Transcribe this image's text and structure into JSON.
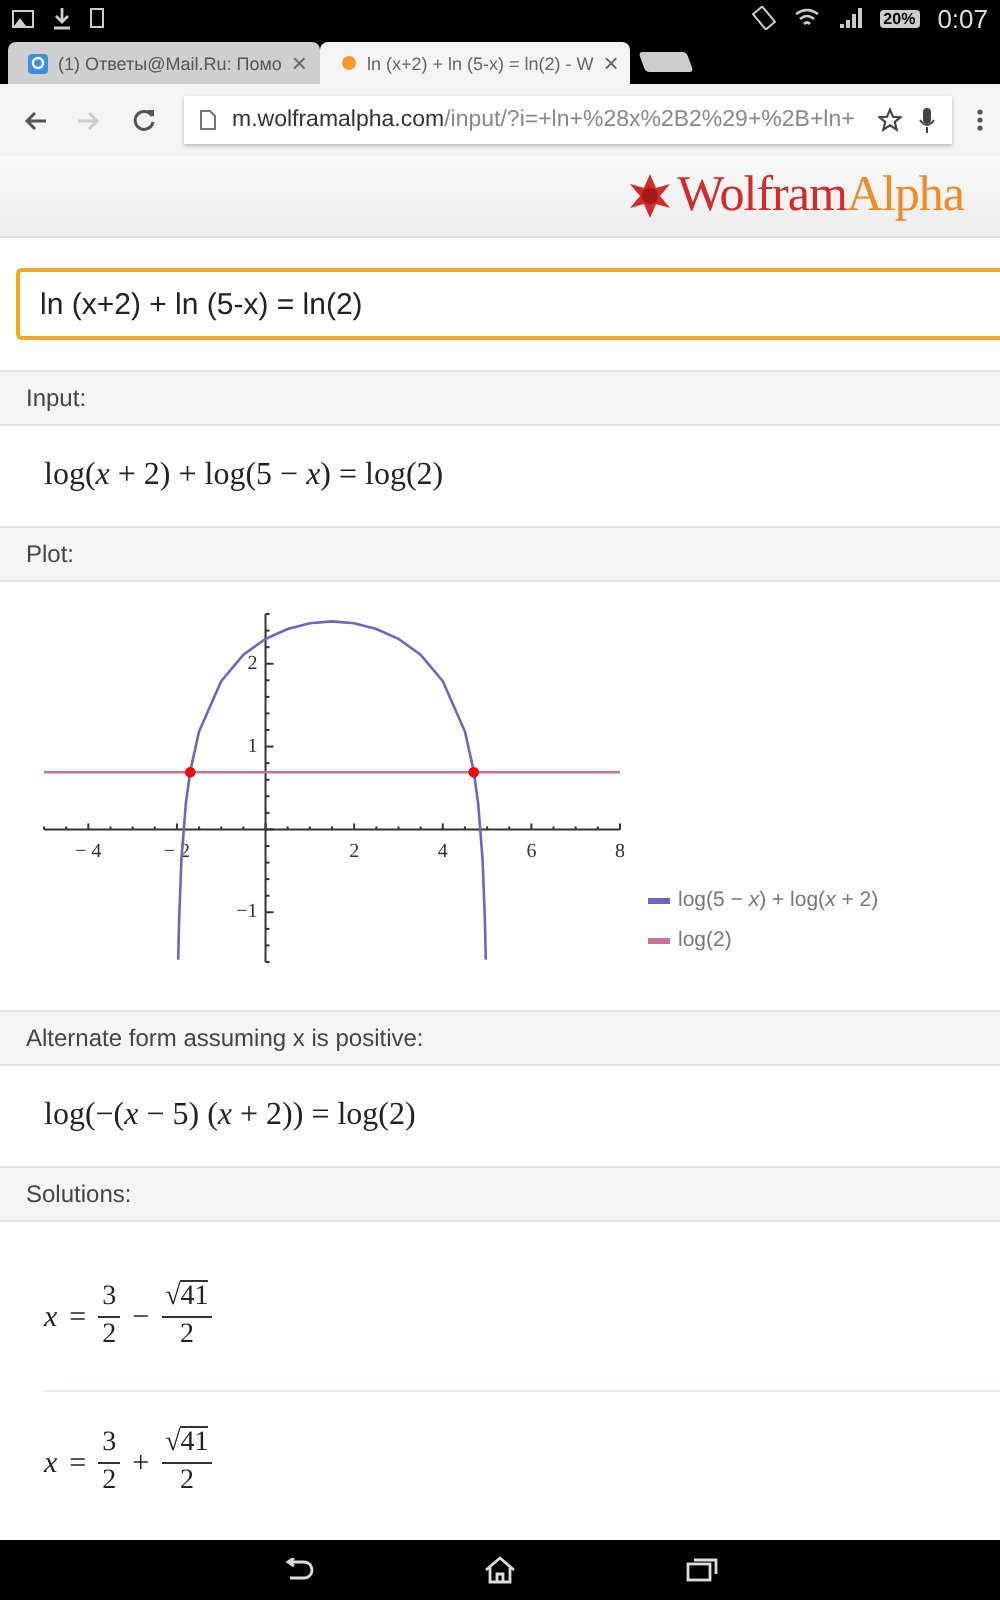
{
  "status_bar": {
    "battery": "20%",
    "time": "0:07"
  },
  "tabs": [
    {
      "title": "(1) Ответы@Mail.Ru: Помо",
      "close": "×",
      "selected": false
    },
    {
      "title": "ln (x+2) + ln (5-x) = ln(2) - W",
      "close": "×",
      "selected": true
    }
  ],
  "address_bar": {
    "host": "m.wolframalpha.com",
    "path": "/input/?i=+ln+%28x%2B2%29+%2B+ln+"
  },
  "logo": {
    "part1": "Wolfram",
    "part2": "Alpha"
  },
  "query": {
    "value": "ln (x+2) + ln (5-x) = ln(2)"
  },
  "pods": [
    {
      "kind": "formula",
      "title": "Input:",
      "formula": "log(*x* + 2) + log(5 − *x*) = log(2)"
    },
    {
      "kind": "plot",
      "title": "Plot:",
      "chart_data": {
        "type": "line",
        "x": [
          -5,
          -1.97,
          -1.95,
          -1.9,
          -1.8,
          -1.7,
          -1.5,
          -1,
          -0.5,
          0,
          0.5,
          1,
          1.5,
          2,
          2.5,
          3,
          3.5,
          4,
          4.5,
          4.7,
          4.8,
          4.9,
          4.95,
          4.97,
          8
        ],
        "xlim": [
          -5,
          8
        ],
        "ylim": [
          -1.6,
          2.6
        ],
        "xticks": [
          -4,
          -2,
          2,
          4,
          6,
          8
        ],
        "yticks": [
          -1,
          1,
          2
        ],
        "series": [
          {
            "name": "log(5 − *x*) + log(*x* + 2)",
            "color": "#6868c0",
            "values": [
              null,
              -1.57,
              -1.06,
              -0.37,
              0.31,
              0.7,
              1.18,
              1.79,
              2.11,
              2.3,
              2.42,
              2.49,
              2.51,
              2.49,
              2.42,
              2.3,
              2.11,
              1.79,
              1.18,
              0.7,
              0.31,
              -0.37,
              -1.06,
              -1.57,
              null
            ]
          },
          {
            "name": "log(2)",
            "color": "#c8729a",
            "values": [
              0.69,
              0.69,
              0.69,
              0.69,
              0.69,
              0.69,
              0.69,
              0.69,
              0.69,
              0.69,
              0.69,
              0.69,
              0.69,
              0.69,
              0.69,
              0.69,
              0.69,
              0.69,
              0.69,
              0.69,
              0.69,
              0.69,
              0.69,
              0.69,
              0.69
            ]
          }
        ]
      }
    },
    {
      "kind": "formula",
      "title": "Alternate form assuming x is positive:",
      "formula": "log(−(*x* − 5) (*x* + 2)) = log(2)"
    },
    {
      "kind": "solutions",
      "title": "Solutions:",
      "solutions": [
        {
          "variable": "x",
          "equals": "=",
          "num1": "3",
          "den1": "2",
          "operator": "−",
          "root": "√",
          "radicand": "41",
          "den2": "2"
        },
        {
          "variable": "x",
          "equals": "=",
          "num1": "3",
          "den1": "2",
          "operator": "+",
          "root": "√",
          "radicand": "41",
          "den2": "2"
        }
      ]
    }
  ]
}
